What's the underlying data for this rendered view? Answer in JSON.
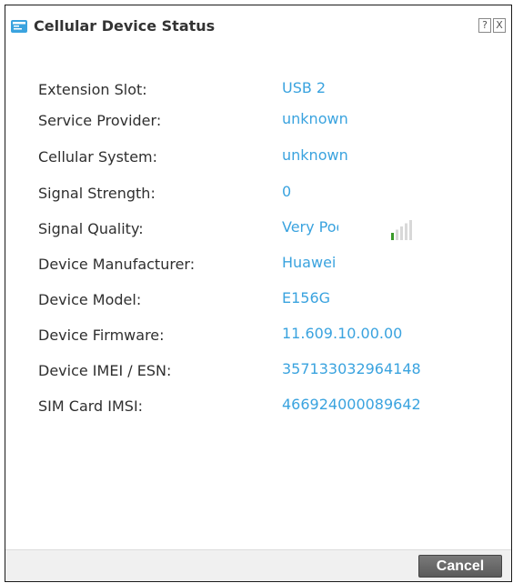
{
  "dialog": {
    "title": "Cellular Device Status",
    "help_icon": "?",
    "close_icon": "X"
  },
  "fields": [
    {
      "label": "Extension Slot:",
      "value": "USB 2"
    },
    {
      "label": "Service Provider:",
      "value": "unknown"
    },
    {
      "label": "Cellular System:",
      "value": "unknown"
    },
    {
      "label": "Signal Strength:",
      "value": "0"
    },
    {
      "label": "Signal Quality:",
      "value": "Very Poor",
      "bars_active": 1,
      "bars_total": 5
    },
    {
      "label": "Device Manufacturer:",
      "value": "Huawei"
    },
    {
      "label": "Device Model:",
      "value": "E156G"
    },
    {
      "label": "Device Firmware:",
      "value": "11.609.10.00.00"
    },
    {
      "label": "Device IMEI / ESN:",
      "value": "357133032964148"
    },
    {
      "label": "SIM Card IMSI:",
      "value": "466924000089642"
    }
  ],
  "footer": {
    "cancel_label": "Cancel"
  },
  "colors": {
    "value_text": "#3aa3df",
    "signal_active": "#3a9a2a",
    "signal_inactive": "#d8d8d8"
  }
}
